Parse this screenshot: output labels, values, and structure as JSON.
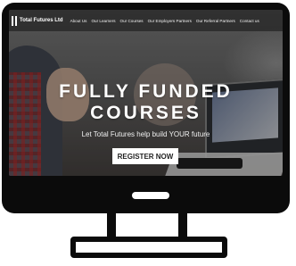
{
  "header": {
    "brand": "Total Futures Ltd",
    "nav": [
      "About Us",
      "Our Learners",
      "Our Courses",
      "Our Employers Partners",
      "Our Referral Partners",
      "Contact us"
    ]
  },
  "hero": {
    "title_line1": "FULLY FUNDED",
    "title_line2": "COURSES",
    "subtitle": "Let Total Futures help build YOUR future",
    "cta_label": "REGISTER NOW"
  },
  "icons": {
    "logo": "total-futures-logo-icon"
  },
  "colors": {
    "monitor": "#0b0b0b",
    "cta_bg": "#ffffff",
    "text": "#ffffff"
  }
}
